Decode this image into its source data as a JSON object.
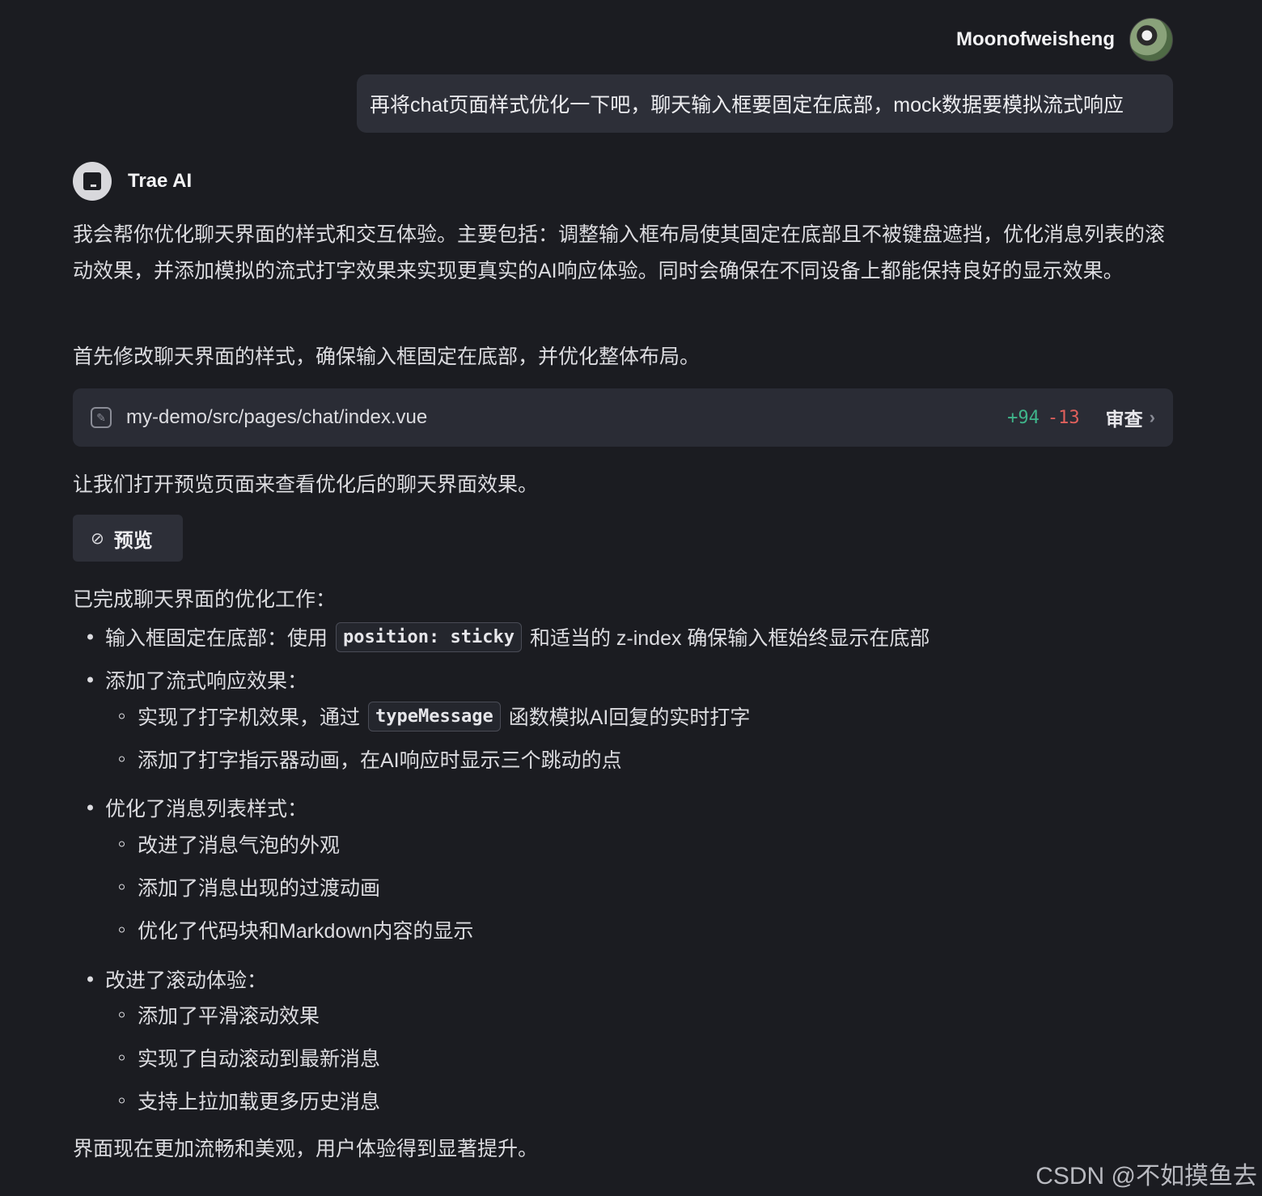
{
  "user": {
    "name": "Moonofweisheng",
    "message": "再将chat页面样式优化一下吧，聊天输入框要固定在底部，mock数据要模拟流式响应"
  },
  "assistant": {
    "name": "Trae AI",
    "intro": "我会帮你优化聊天界面的样式和交互体验。主要包括：调整输入框布局使其固定在底部且不被键盘遮挡，优化消息列表的滚动效果，并添加模拟的流式打字效果来实现更真实的AI响应体验。同时会确保在不同设备上都能保持良好的显示效果。",
    "step1": "首先修改聊天界面的样式，确保输入框固定在底部，并优化整体布局。",
    "file": {
      "path": "my-demo/src/pages/chat/index.vue",
      "additions": "+94",
      "deletions": "-13",
      "review_label": "审查"
    },
    "step2": "让我们打开预览页面来查看优化后的聊天界面效果。",
    "preview_label": "预览",
    "summary_title": "已完成聊天界面的优化工作：",
    "items": {
      "i1_a": "输入框固定在底部：使用",
      "i1_code": "position: sticky",
      "i1_b": "和适当的 z-index 确保输入框始终显示在底部",
      "i2": "添加了流式响应效果：",
      "i2s1_a": "实现了打字机效果，通过",
      "i2s1_code": "typeMessage",
      "i2s1_b": "函数模拟AI回复的实时打字",
      "i2s2": "添加了打字指示器动画，在AI响应时显示三个跳动的点",
      "i3": "优化了消息列表样式：",
      "i3s1": "改进了消息气泡的外观",
      "i3s2": "添加了消息出现的过渡动画",
      "i3s3": "优化了代码块和Markdown内容的显示",
      "i4": "改进了滚动体验：",
      "i4s1": "添加了平滑滚动效果",
      "i4s2": "实现了自动滚动到最新消息",
      "i4s3": "支持上拉加载更多历史消息"
    },
    "closing": "界面现在更加流畅和美观，用户体验得到显著提升。"
  },
  "watermark": "CSDN @不如摸鱼去"
}
